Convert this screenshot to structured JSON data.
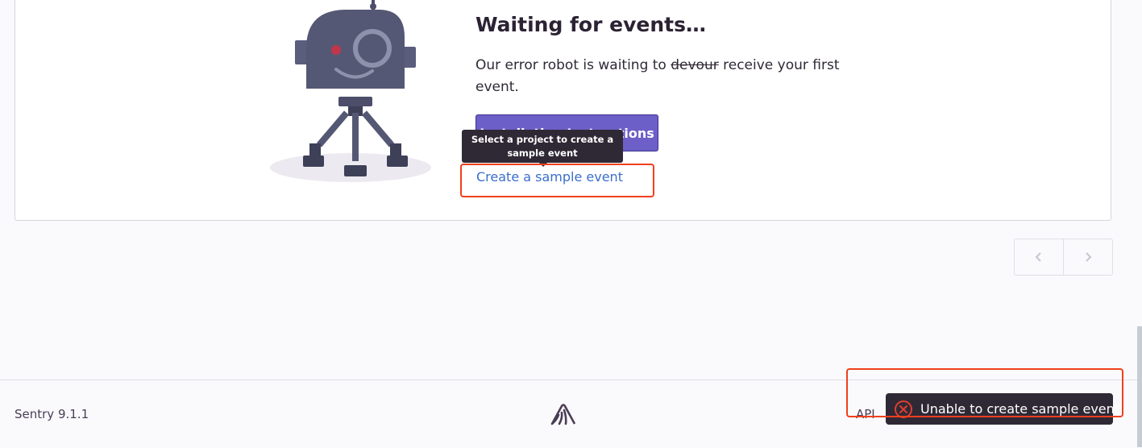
{
  "empty_state": {
    "title": "Waiting for events…",
    "description_before": "Our error robot is waiting to ",
    "description_struck": "devour",
    "description_after": " receive your first event.",
    "install_button_label": "Installation Instructions",
    "sample_link_label": "Create a sample event",
    "tooltip_text": "Select a project to create a sample event"
  },
  "pagination": {
    "prev_icon": "chevron-left-icon",
    "next_icon": "chevron-right-icon"
  },
  "footer": {
    "version": "Sentry 9.1.1",
    "api_label": "API"
  },
  "toast": {
    "icon": "error-circle-icon",
    "message": "Unable to create sample event"
  },
  "colors": {
    "accent": "#6c5fc7",
    "link": "#3b6ecc",
    "highlight": "#f0401c",
    "toast_bg": "#2f2936",
    "error": "#e03e2f"
  }
}
